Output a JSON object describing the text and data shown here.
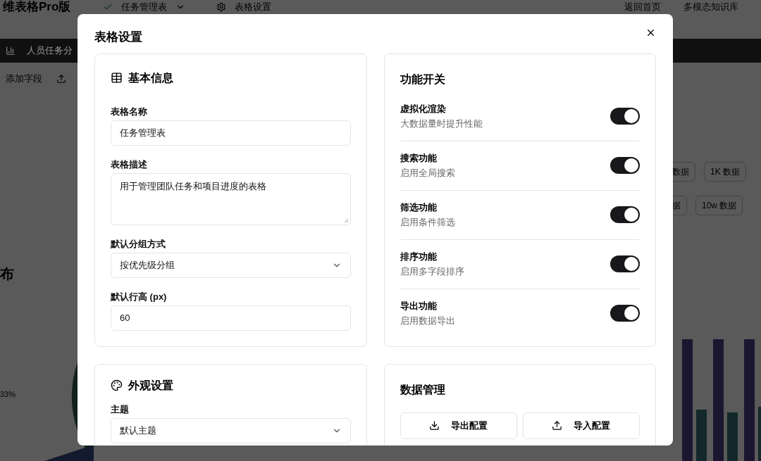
{
  "background": {
    "app_title": "维表格Pro版",
    "table_name": "任务管理表",
    "settings_link": "表格设置",
    "nav_links": [
      "返回首页",
      "多模态知识库"
    ],
    "view_tab": "人员任务分",
    "toolbar_button": "添加字段",
    "chart_title": "布",
    "pie_label": "33%",
    "data_buttons_top": [
      "数据",
      "1K 数据"
    ],
    "data_buttons_bottom": [
      "据",
      "10w 数据"
    ]
  },
  "dialog": {
    "title": "表格设置",
    "basic_info": {
      "title": "基本信息",
      "fields": [
        {
          "label": "表格名称",
          "kind": "input",
          "value": "任务管理表"
        },
        {
          "label": "表格描述",
          "kind": "textarea",
          "value": "用于管理团队任务和项目进度的表格"
        },
        {
          "label": "默认分组方式",
          "kind": "select",
          "value": "按优先级分组"
        },
        {
          "label": "默认行高 (px)",
          "kind": "input",
          "value": "60"
        }
      ]
    },
    "features": {
      "title": "功能开关",
      "toggles": [
        {
          "name": "虚拟化渲染",
          "description": "大数据量时提升性能",
          "on": true
        },
        {
          "name": "搜索功能",
          "description": "启用全局搜索",
          "on": true
        },
        {
          "name": "筛选功能",
          "description": "启用条件筛选",
          "on": true
        },
        {
          "name": "排序功能",
          "description": "启用多字段排序",
          "on": true
        },
        {
          "name": "导出功能",
          "description": "启用数据导出",
          "on": true
        }
      ]
    },
    "appearance": {
      "title": "外观设置",
      "fields": [
        {
          "label": "主题",
          "kind": "select",
          "value": "默认主题"
        }
      ]
    },
    "data_management": {
      "title": "数据管理",
      "buttons": [
        {
          "label": "导出配置",
          "kind": "export"
        },
        {
          "label": "导入配置",
          "kind": "import"
        }
      ]
    }
  }
}
